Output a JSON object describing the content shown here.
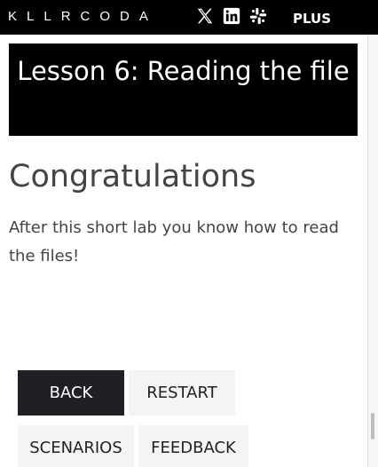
{
  "header": {
    "logo_text": "KLLRCODA",
    "social_icons": [
      "x-icon",
      "linkedin-icon",
      "slack-icon"
    ],
    "plus_label": "PLUS"
  },
  "lesson": {
    "title": "Lesson 6: Reading the file",
    "heading": "Congratulations",
    "body": "After this short lab you know how to read the files!"
  },
  "buttons": {
    "back": "BACK",
    "restart": "RESTART",
    "scenarios": "SCENARIOS",
    "feedback": "FEEDBACK"
  },
  "colors": {
    "topbar": "#000000",
    "title_bg": "#000000",
    "primary_button": "#1e2023",
    "secondary_button": "#f4f4f4"
  }
}
